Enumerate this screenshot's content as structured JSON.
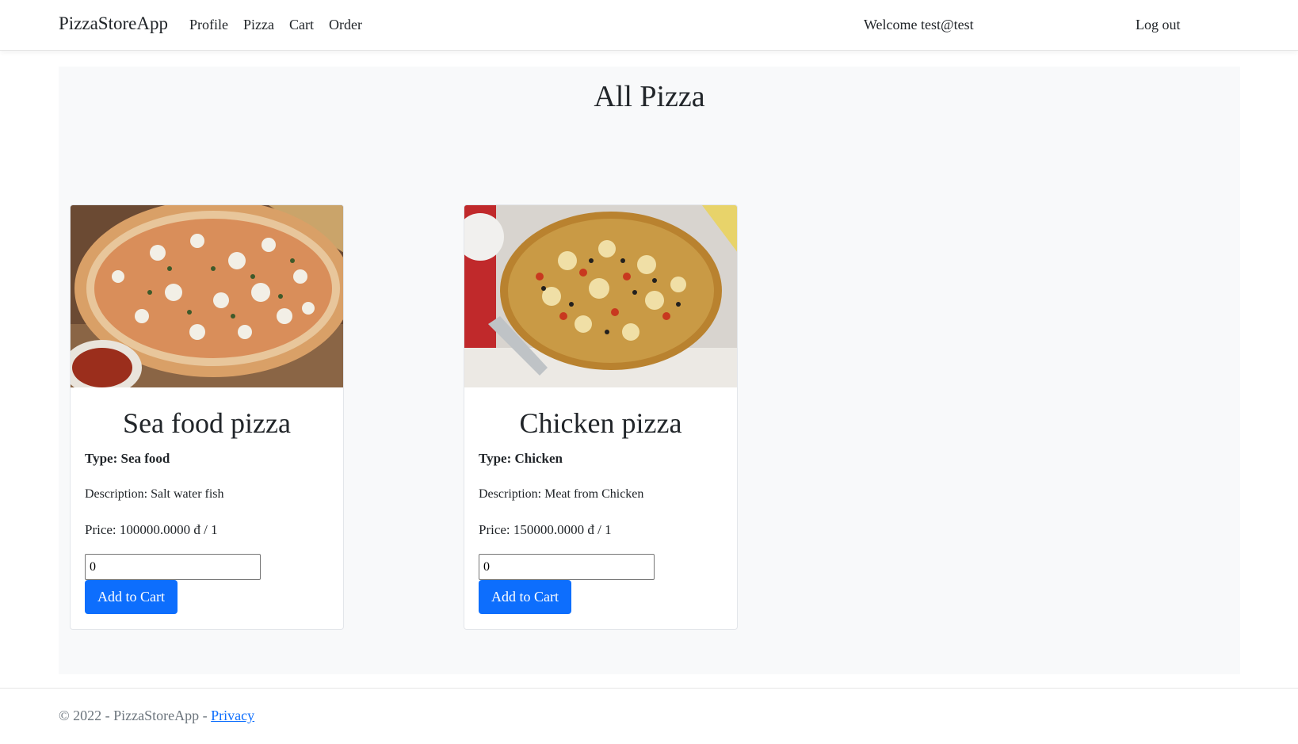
{
  "navbar": {
    "brand": "PizzaStoreApp",
    "links": [
      "Profile",
      "Pizza",
      "Cart",
      "Order"
    ],
    "welcome": "Welcome test@test",
    "logout": "Log out"
  },
  "main": {
    "title": "All Pizza",
    "cards": [
      {
        "name": "Sea food pizza",
        "type": "Type: Sea food",
        "description": "Description: Salt water fish",
        "price": "Price: 100000.0000 đ / 1",
        "quantity": "0",
        "button": "Add to Cart"
      },
      {
        "name": "Chicken pizza",
        "type": "Type: Chicken",
        "description": "Description: Meat from Chicken",
        "price": "Price: 150000.0000 đ / 1",
        "quantity": "0",
        "button": "Add to Cart"
      }
    ]
  },
  "footer": {
    "copyright": "© 2022 - PizzaStoreApp - ",
    "privacy": "Privacy"
  },
  "colors": {
    "accent": "#0d6efd",
    "page_background": "#f8f9fa"
  }
}
